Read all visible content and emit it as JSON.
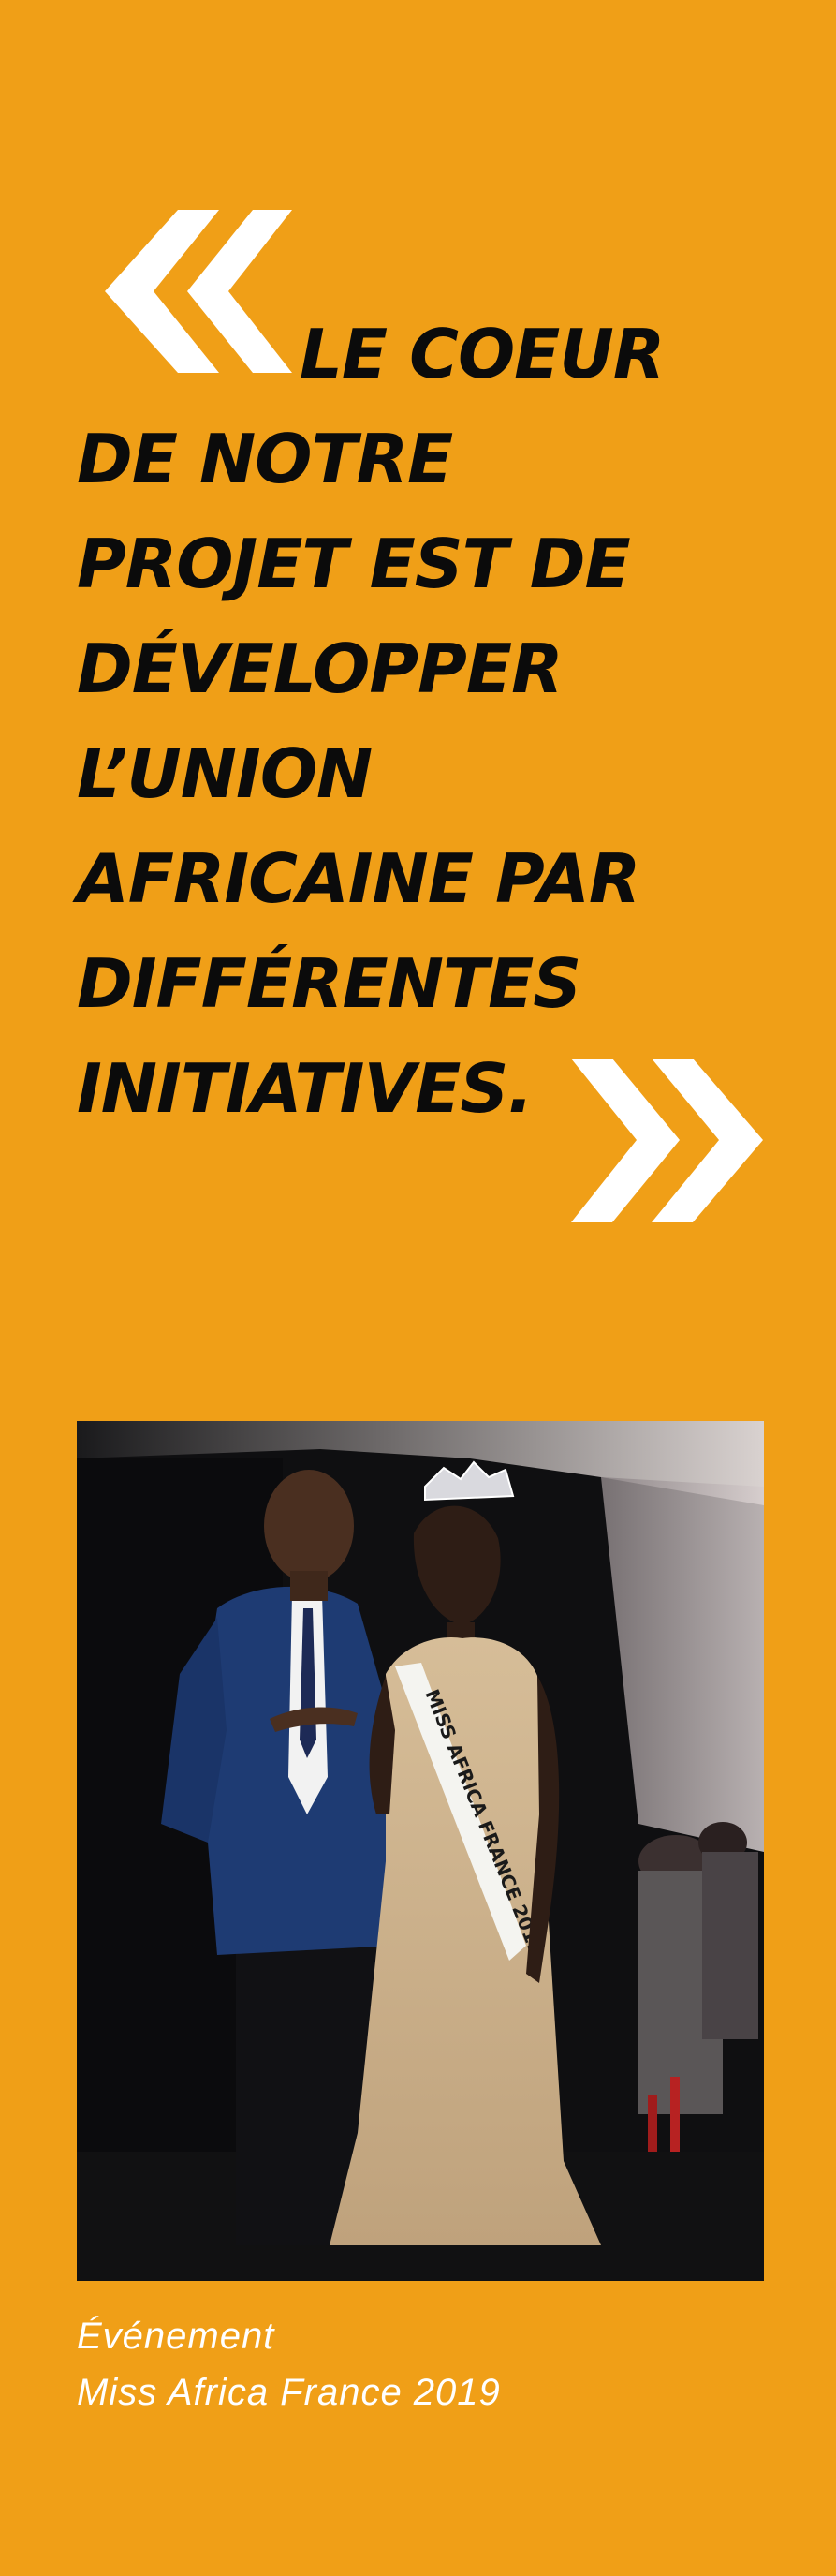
{
  "accent_color": "#F09F17",
  "text_color": "#0B0B0B",
  "quote_mark_color": "#FFFFFF",
  "quote": {
    "open_mark_icon": "double-chevron-left-icon",
    "close_mark_icon": "double-chevron-right-icon",
    "lines": [
      "LE COEUR",
      "DE NOTRE",
      "PROJET EST DE",
      "DÉVELOPPER",
      "L’UNION",
      "AFRICAINE PAR",
      "DIFFÉRENTES",
      "INITIATIVES."
    ]
  },
  "photo": {
    "sash_text": "MISS AFRICA FRANCE 2019"
  },
  "caption": {
    "line1": "Événement",
    "line2": "Miss Africa France 2019"
  }
}
